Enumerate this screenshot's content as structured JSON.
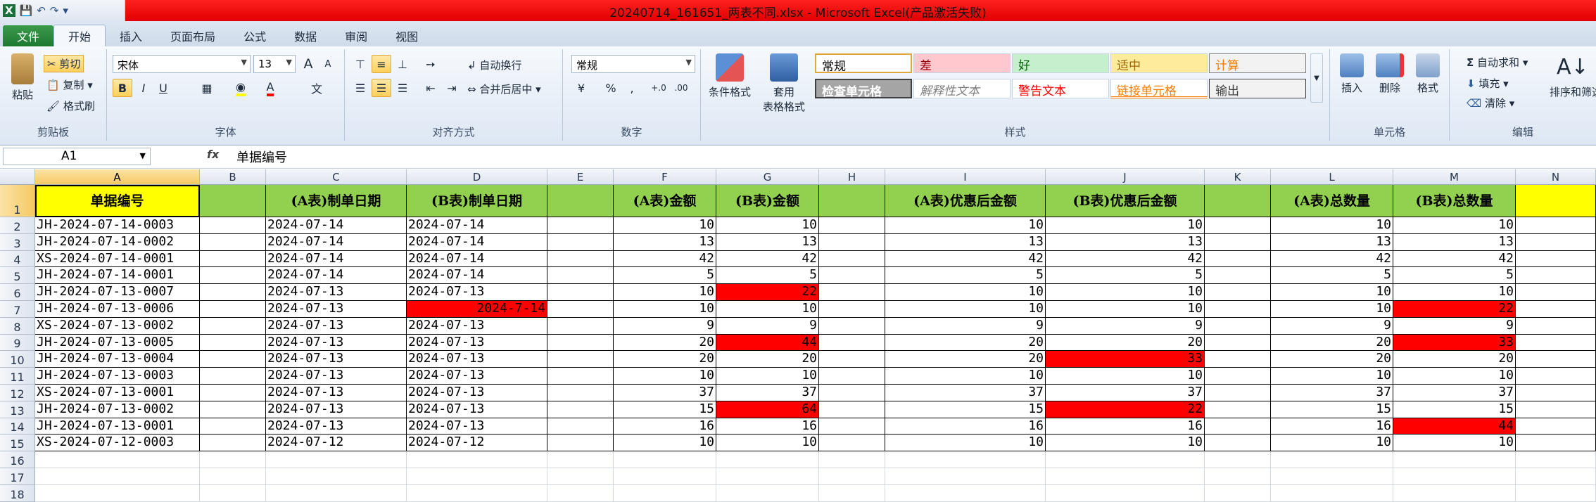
{
  "window": {
    "title": "20240714_161651_两表不同.xlsx - Microsoft Excel(产品激活失败)"
  },
  "qat": {
    "icons": [
      "excel-icon",
      "save-icon",
      "undo-icon",
      "redo-icon",
      "customize-icon"
    ]
  },
  "tabs": [
    "文件",
    "开始",
    "插入",
    "页面布局",
    "公式",
    "数据",
    "审阅",
    "视图"
  ],
  "ribbon": {
    "clipboard": {
      "label": "剪贴板",
      "paste": "粘贴",
      "cut": "剪切",
      "copy": "复制",
      "format_painter": "格式刷"
    },
    "font": {
      "label": "字体",
      "name": "宋体",
      "size": "13",
      "grow": "A",
      "shrink": "A",
      "bold": "B",
      "italic": "I",
      "underline": "U",
      "phonetic": "文"
    },
    "alignment": {
      "label": "对齐方式",
      "wrap": "自动换行",
      "merge": "合并后居中"
    },
    "number": {
      "label": "数字",
      "format": "常规",
      "percent": "%",
      "comma": ",",
      "inc": "+.0",
      "dec": ".00"
    },
    "styles": {
      "label": "样式",
      "conditional": "条件格式",
      "table_fmt_1": "套用",
      "table_fmt_2": "表格格式",
      "cells": [
        {
          "text": "常规",
          "bg": "#ffffff",
          "color": "#000000"
        },
        {
          "text": "差",
          "bg": "#ffc7ce",
          "color": "#9c0006"
        },
        {
          "text": "好",
          "bg": "#c6efce",
          "color": "#006100"
        },
        {
          "text": "适中",
          "bg": "#ffeb9c",
          "color": "#9c6500"
        },
        {
          "text": "计算",
          "bg": "#f2f2f2",
          "color": "#fa7d00"
        },
        {
          "text": "检查单元格",
          "bg": "#a5a5a5",
          "color": "#ffffff"
        },
        {
          "text": "解释性文本",
          "bg": "#ffffff",
          "color": "#7f7f7f"
        },
        {
          "text": "警告文本",
          "bg": "#ffffff",
          "color": "#ff0000"
        },
        {
          "text": "链接单元格",
          "bg": "#ffffff",
          "color": "#fa7d00"
        },
        {
          "text": "输出",
          "bg": "#f2f2f2",
          "color": "#3f3f3f"
        }
      ]
    },
    "cells": {
      "label": "单元格",
      "insert": "插入",
      "delete": "删除",
      "format": "格式"
    },
    "editing": {
      "label": "编辑",
      "autosum": "自动求和",
      "fill": "填充",
      "clear": "清除",
      "sort": "排序和筛选"
    }
  },
  "formula_bar": {
    "name_box": "A1",
    "fx": "fx",
    "content": "单据编号"
  },
  "columns": [
    "A",
    "B",
    "C",
    "D",
    "E",
    "F",
    "G",
    "H",
    "I",
    "J",
    "K",
    "L",
    "M",
    "N"
  ],
  "header_row": [
    "单据编号",
    "",
    "(A表)制单日期",
    "(B表)制单日期",
    "",
    "(A表)金额",
    "(B表)金额",
    "",
    "(A表)优惠后金额",
    "(B表)优惠后金额",
    "",
    "(A表)总数量",
    "(B表)总数量",
    ""
  ],
  "rows": [
    [
      "JH-2024-07-14-0003",
      "2024-07-14",
      "2024-07-14",
      "10",
      "10",
      "10",
      "10",
      "10",
      "10"
    ],
    [
      "JH-2024-07-14-0002",
      "2024-07-14",
      "2024-07-14",
      "13",
      "13",
      "13",
      "13",
      "13",
      "13"
    ],
    [
      "XS-2024-07-14-0001",
      "2024-07-14",
      "2024-07-14",
      "42",
      "42",
      "42",
      "42",
      "42",
      "42"
    ],
    [
      "JH-2024-07-14-0001",
      "2024-07-14",
      "2024-07-14",
      "5",
      "5",
      "5",
      "5",
      "5",
      "5"
    ],
    [
      "JH-2024-07-13-0007",
      "2024-07-13",
      "2024-07-13",
      "10",
      "22",
      "10",
      "10",
      "10",
      "10"
    ],
    [
      "JH-2024-07-13-0006",
      "2024-07-13",
      "2024-7-14",
      "10",
      "10",
      "10",
      "10",
      "10",
      "22"
    ],
    [
      "XS-2024-07-13-0002",
      "2024-07-13",
      "2024-07-13",
      "9",
      "9",
      "9",
      "9",
      "9",
      "9"
    ],
    [
      "JH-2024-07-13-0005",
      "2024-07-13",
      "2024-07-13",
      "20",
      "44",
      "20",
      "20",
      "20",
      "33"
    ],
    [
      "JH-2024-07-13-0004",
      "2024-07-13",
      "2024-07-13",
      "20",
      "20",
      "20",
      "33",
      "20",
      "20"
    ],
    [
      "JH-2024-07-13-0003",
      "2024-07-13",
      "2024-07-13",
      "10",
      "10",
      "10",
      "10",
      "10",
      "10"
    ],
    [
      "XS-2024-07-13-0001",
      "2024-07-13",
      "2024-07-13",
      "37",
      "37",
      "37",
      "37",
      "37",
      "37"
    ],
    [
      "JH-2024-07-13-0002",
      "2024-07-13",
      "2024-07-13",
      "15",
      "64",
      "15",
      "22",
      "15",
      "15"
    ],
    [
      "JH-2024-07-13-0001",
      "2024-07-13",
      "2024-07-13",
      "16",
      "16",
      "16",
      "16",
      "16",
      "44"
    ],
    [
      "XS-2024-07-12-0003",
      "2024-07-12",
      "2024-07-12",
      "10",
      "10",
      "10",
      "10",
      "10",
      "10"
    ]
  ],
  "row_numbers": [
    "1",
    "2",
    "3",
    "4",
    "5",
    "6",
    "7",
    "8",
    "9",
    "10",
    "11",
    "12",
    "13",
    "14",
    "15",
    "16",
    "17",
    "18"
  ],
  "highlight_color": "#ff0000",
  "header_green": "#92d050",
  "header_yellow": "#ffff00"
}
